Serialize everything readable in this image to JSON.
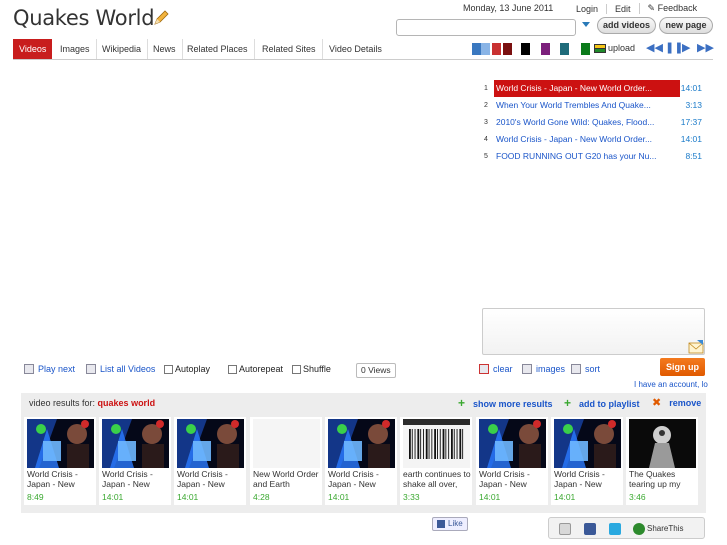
{
  "header": {
    "site_title": "Quakes World",
    "date": "Monday, 13 June 2011",
    "links": [
      "Login",
      "Edit",
      "Feedback"
    ],
    "search_placeholder": "",
    "add_videos": "add videos",
    "new_page": "new page"
  },
  "nav": {
    "tabs": [
      "Videos",
      "Images",
      "Wikipedia",
      "News",
      "Related Places",
      "Related Sites",
      "Video Details"
    ],
    "active_tab": "Videos",
    "swatches": [
      "#3a78c0",
      "#89b4e6",
      "#c93131",
      "#7a1010",
      "#ffffff",
      "#000000",
      "#ffffff",
      "#7b1f7b",
      "#ffffff",
      "#1f6b7a",
      "#ffffff",
      "#0a7a1a"
    ],
    "upload_label": "upload"
  },
  "playlist": [
    {
      "num": "1",
      "title": "World Crisis - Japan - New World Order...",
      "time": "14:01",
      "active": true
    },
    {
      "num": "2",
      "title": "When Your World Trembles And Quake...",
      "time": "3:13",
      "active": false
    },
    {
      "num": "3",
      "title": "2010's World Gone Wild: Quakes, Flood...",
      "time": "17:37",
      "active": false
    },
    {
      "num": "4",
      "title": "World Crisis - Japan - New World Order...",
      "time": "14:01",
      "active": false
    },
    {
      "num": "5",
      "title": "FOOD RUNNING OUT G20 has your Nu...",
      "time": "8:51",
      "active": false
    }
  ],
  "controls": {
    "play_next": "Play next",
    "list_all": "List all Videos",
    "autoplay": "Autoplay",
    "autorepeat": "Autorepeat",
    "shuffle": "Shuffle",
    "views": "0 Views",
    "clear": "clear",
    "images": "images",
    "sort": "sort",
    "signup": "Sign up",
    "have_account": "I have an account, lo"
  },
  "results": {
    "label": "video results for:",
    "query": "quakes world",
    "show_more": "show more results",
    "add_playlist": "add to playlist",
    "remove": "remove",
    "cards": [
      {
        "title": "World Crisis - Japan - New",
        "duration": "8:49",
        "thumb": "concert"
      },
      {
        "title": "World Crisis - Japan - New",
        "duration": "14:01",
        "thumb": "concert"
      },
      {
        "title": "World Crisis - Japan - New",
        "duration": "14:01",
        "thumb": "concert"
      },
      {
        "title": "New World Order and Earth",
        "duration": "4:28",
        "thumb": "blank"
      },
      {
        "title": "World Crisis - Japan - New",
        "duration": "14:01",
        "thumb": "concert"
      },
      {
        "title": "earth continues to shake all over,",
        "duration": "3:33",
        "thumb": "barcode"
      },
      {
        "title": "World Crisis - Japan - New",
        "duration": "14:01",
        "thumb": "concert"
      },
      {
        "title": "World Crisis - Japan - New",
        "duration": "14:01",
        "thumb": "concert"
      },
      {
        "title": "The Quakes tearing up my",
        "duration": "3:46",
        "thumb": "bw"
      }
    ]
  },
  "footer": {
    "like": "Like",
    "share_this": "ShareThis"
  }
}
